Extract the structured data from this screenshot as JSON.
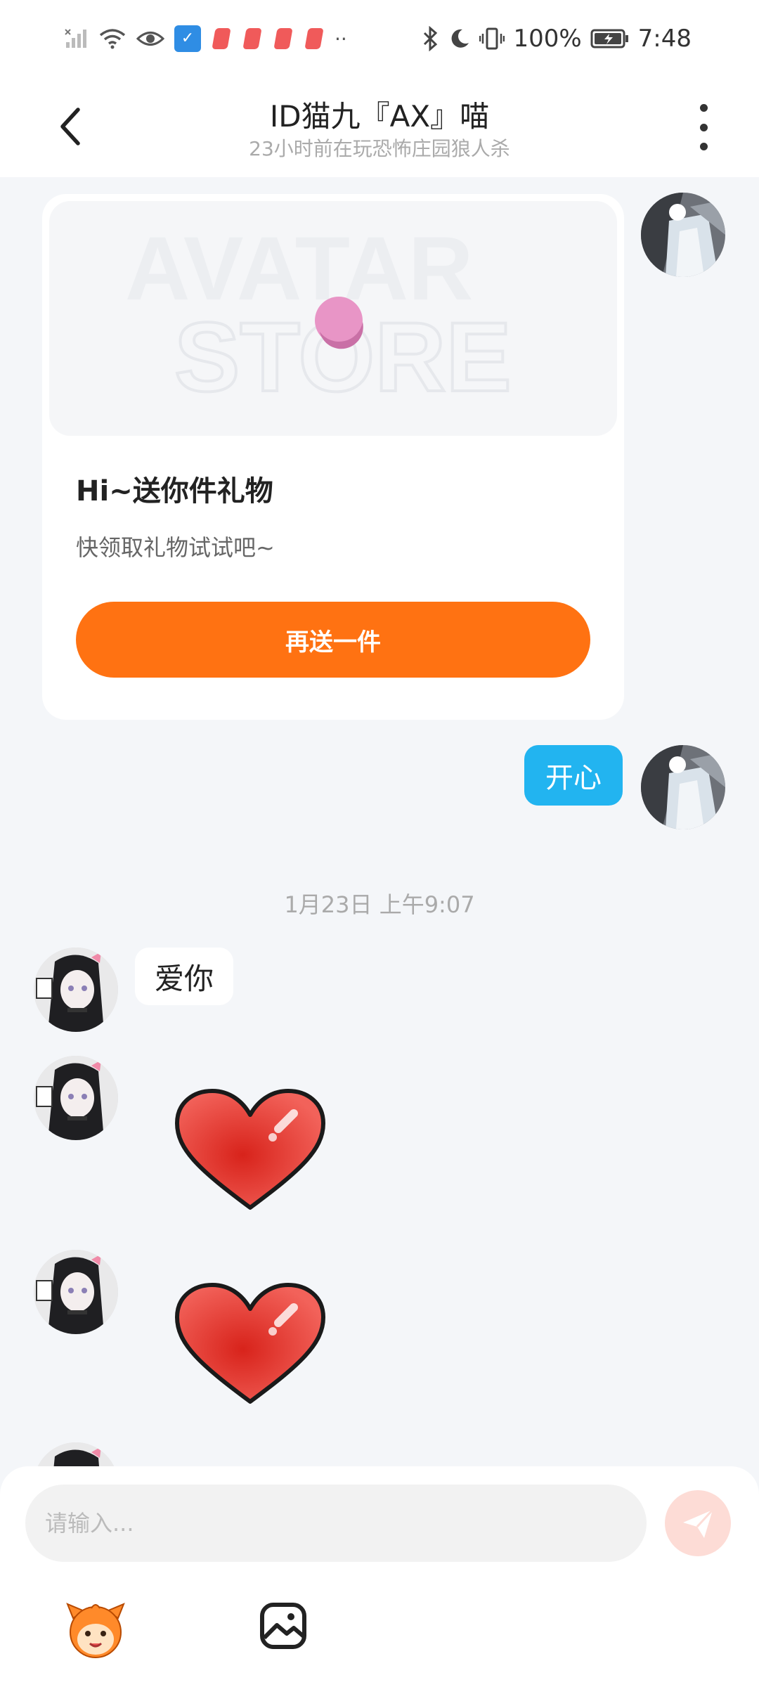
{
  "status_bar": {
    "battery": "100%",
    "time": "7:48"
  },
  "header": {
    "title": "ID猫九『AX』喵",
    "subtitle": "23小时前在玩恐怖庄园狼人杀"
  },
  "gift_card": {
    "banner_text_1": "AVATAR",
    "banner_text_2": "STORE",
    "heading": "Hi~送你件礼物",
    "description": "快领取礼物试试吧~",
    "button_label": "再送一件"
  },
  "messages": {
    "outgoing_1": "开心",
    "timestamp": "1月23日 上午9:07",
    "incoming_1": "爱你"
  },
  "input": {
    "placeholder": "请输入..."
  },
  "colors": {
    "accent_orange": "#ff7212",
    "bubble_blue": "#22b4f0",
    "send_pink": "#fddcd6"
  },
  "icons": [
    "back-icon",
    "more-icon",
    "send-icon",
    "emoji-mascot-icon",
    "image-icon",
    "heart-sticker-icon"
  ]
}
